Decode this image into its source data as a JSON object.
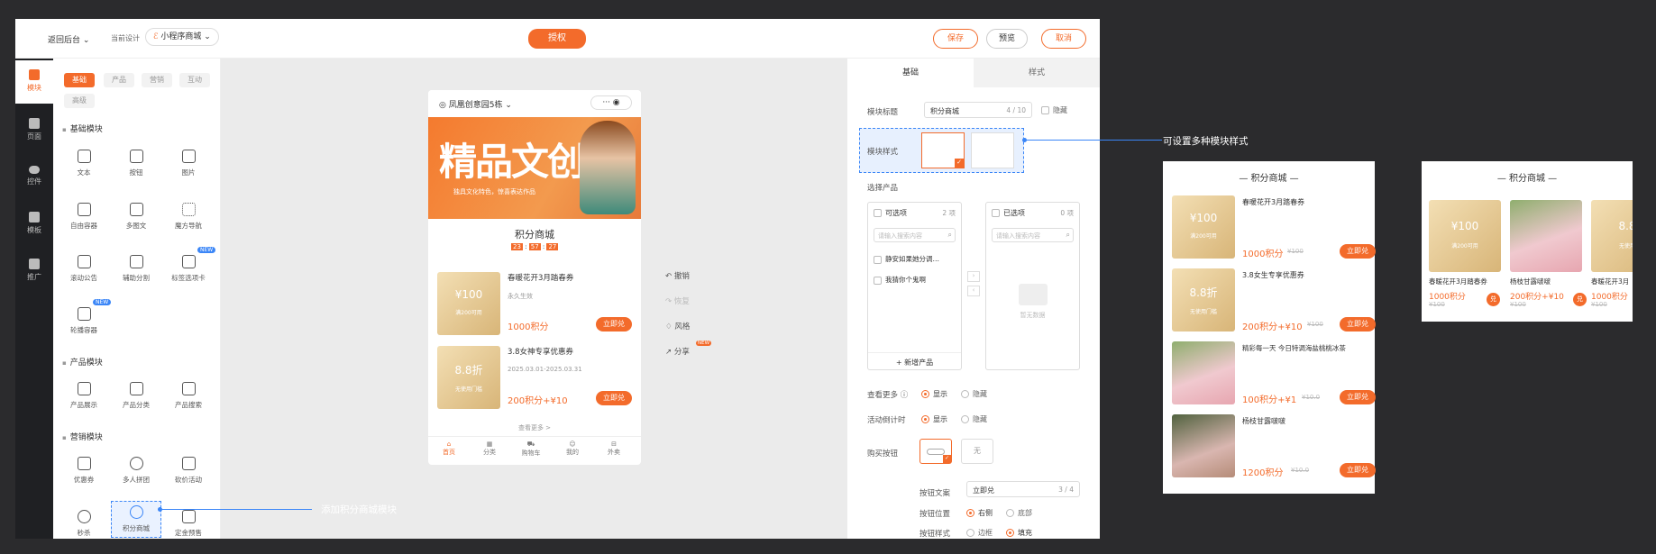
{
  "topbar": {
    "back": "返回后台",
    "current_design_label": "当前设计",
    "app_selector": "小程序商城",
    "authorize": "授权",
    "save": "保存",
    "preview": "预览",
    "cancel": "取消"
  },
  "rail": [
    {
      "label": "模块"
    },
    {
      "label": "页面"
    },
    {
      "label": "控件"
    },
    {
      "label": "模板"
    },
    {
      "label": "推广"
    }
  ],
  "library": {
    "tabs": [
      "基础",
      "产品",
      "营销",
      "互动",
      "高级"
    ],
    "sections": [
      {
        "title": "基础模块",
        "items": [
          "文本",
          "按钮",
          "图片",
          "自由容器",
          "多图文",
          "魔方导航",
          "滚动公告",
          "辅助分割",
          "标签选项卡",
          "轮播容器"
        ]
      },
      {
        "title": "产品模块",
        "items": [
          "产品展示",
          "产品分类",
          "产品搜索"
        ]
      },
      {
        "title": "营销模块",
        "items": [
          "优惠券",
          "多人拼团",
          "砍价活动",
          "秒杀",
          "积分商城",
          "定金预售"
        ]
      }
    ],
    "new_badge": "NEW"
  },
  "phone": {
    "location": "凤凰创意园5栋",
    "banner_title": "精品文创",
    "banner_sub": "独具文化特色，惊喜表达作品",
    "module_title": "积分商城",
    "countdown": [
      "23",
      "57",
      "27"
    ],
    "items": [
      {
        "name": "春暖花开3月踏春券",
        "sub": "永久生效",
        "coupon_top": "¥100",
        "coupon_bottom": "满200可用",
        "price": "1000积分",
        "btn": "立即兑"
      },
      {
        "name": "3.8女神专享优惠券",
        "sub": "2025.03.01-2025.03.31",
        "coupon_top": "8.8折",
        "coupon_bottom": "无使用门槛",
        "price": "200积分+¥10",
        "btn": "立即兑"
      }
    ],
    "more": "查看更多 >",
    "tabs": [
      "首页",
      "分类",
      "购物车",
      "我的",
      "外卖"
    ]
  },
  "side_actions": [
    {
      "label": "撤销"
    },
    {
      "label": "恢复"
    },
    {
      "label": "风格"
    },
    {
      "label": "分享"
    }
  ],
  "side_new": "NEW",
  "props": {
    "tabs": [
      "基础",
      "样式"
    ],
    "module_title_label": "模块标题",
    "module_title_value": "积分商城",
    "module_title_count": "4 / 10",
    "hide": "隐藏",
    "module_style_label": "模块样式",
    "select_product_label": "选择产品",
    "left_list": {
      "header": "可选项",
      "count": "2 项",
      "search": "请输入搜索内容",
      "items": [
        "静安如果她分调…",
        "我猜你个鬼啊"
      ],
      "add": "+ 新增产品"
    },
    "right_list": {
      "header": "已选项",
      "count": "0 项",
      "search": "请输入搜索内容",
      "empty": "暂无数据"
    },
    "see_more_label": "查看更多",
    "show": "显示",
    "hide2": "隐藏",
    "countdown_label": "活动倒计时",
    "buy_btn_label": "购买按钮",
    "none": "无",
    "btn_text_label": "按钮文案",
    "btn_text_value": "立即兑",
    "btn_text_count": "3 / 4",
    "btn_pos_label": "按钮位置",
    "right": "右侧",
    "bottom": "底部",
    "btn_style_label": "按钮样式",
    "border": "边框",
    "fill": "填充"
  },
  "annotations": {
    "add_module": "添加积分商城模块",
    "styles": "可设置多种模块样式"
  },
  "preview_list": {
    "title": "积分商城",
    "items": [
      {
        "name": "春暖花开3月踏春券",
        "coupon_top": "¥100",
        "coupon_bottom": "满200可用",
        "price": "1000积分",
        "old": "¥100",
        "btn": "立即兑"
      },
      {
        "name": "3.8女生专享优惠券",
        "coupon_top": "8.8折",
        "coupon_bottom": "无使用门槛",
        "price": "200积分+¥10",
        "old": "¥100",
        "btn": "立即兑"
      },
      {
        "name": "精彩每一天 今日特调海盐桃桃冰茶",
        "price": "100积分+¥1",
        "old": "¥10.0",
        "btn": "立即兑"
      },
      {
        "name": "杨枝甘露啵啵",
        "price": "1200积分",
        "old": "¥10.0",
        "btn": "立即兑"
      }
    ]
  },
  "preview_grid": {
    "title": "积分商城",
    "items": [
      {
        "name": "春暖花开3月踏春券",
        "coupon_top": "¥100",
        "coupon_bottom": "满200可用",
        "price": "1000积分",
        "old": "¥100",
        "btn": "兑"
      },
      {
        "name": "杨枝甘露啵啵",
        "price": "200积分+¥10",
        "old": "¥100",
        "btn": "兑"
      },
      {
        "name": "春暖花开3月",
        "coupon_top": "8.8",
        "coupon_bottom": "无使用",
        "price": "1000积分",
        "old": "¥100"
      }
    ]
  },
  "colors": {
    "accent": "#f36b2b",
    "link": "#3b86f7"
  }
}
